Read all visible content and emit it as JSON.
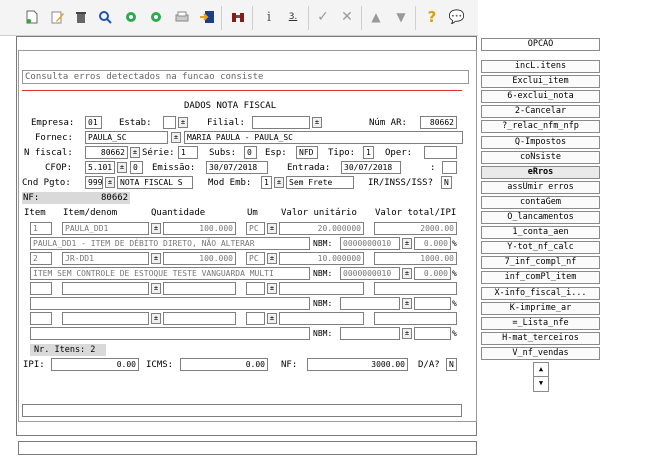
{
  "toolbar": {
    "icons": [
      "new-doc-icon",
      "edit-pencil-icon",
      "trash-icon",
      "search-icon",
      "circle-green-icon",
      "circle-green-2-icon",
      "print-icon",
      "exit-icon",
      "binoculars-icon",
      "info-i-icon",
      "info-3-icon",
      "check-icon",
      "cross-icon",
      "up-triangle-icon",
      "down-triangle-icon",
      "help-question-icon",
      "chat-icon"
    ],
    "info_3": "3."
  },
  "search_placeholder": "Consulta erros detectados na funcao consiste",
  "header_title": "DADOS NOTA FISCAL",
  "form": {
    "empresa_label": "Empresa:",
    "empresa": "01",
    "estab_label": "Estab:",
    "estab": "",
    "filial_label": "Filial:",
    "filial": "",
    "num_ar_label": "Núm AR:",
    "num_ar": "80662",
    "fornec_label": "Fornec:",
    "fornec_code": "PAULA_SC",
    "fornec_name": "MARIA PAULA - PAULA_SC",
    "nfiscal_label": "N fiscal:",
    "nfiscal": "80662",
    "serie_label": "Série:",
    "serie": "1",
    "subs_label": "Subs:",
    "subs": "0",
    "esp_label": "Esp:",
    "esp": "NFD",
    "tipo_label": "Tipo:",
    "tipo": "1",
    "oper_label": "Oper:",
    "oper": "",
    "cfop_label": "CFOP:",
    "cfop": "5.101",
    "cfop_seq": "0",
    "emissao_label": "Emissão:",
    "emissao": "30/07/2018",
    "entrada_label": "Entrada:",
    "entrada": "30/07/2018",
    "colon_label": ":",
    "cnd_label": "Cnd Pgto:",
    "cnd_code": "999",
    "cnd_desc": "NOTA FISCAL S",
    "modemb_label": "Mod Emb:",
    "modemb": "1",
    "modemb_desc": "Sem Frete",
    "ir_label": "IR/INSS/ISS?",
    "ir": "N",
    "nf_status_label": "NF:",
    "nf_status_value": "80662"
  },
  "items_header": {
    "item": "Item",
    "item_denom": "Item/denom",
    "quantidade": "Quantidade",
    "um": "Um",
    "valor_unitario": "Valor unitário",
    "valor_total": "Valor total/IPI"
  },
  "items": [
    {
      "item": "1",
      "code": "PAULA_DD1",
      "qty": "100.000",
      "um": "PC",
      "unit": "20.000000",
      "total": "2000.00",
      "desc": "PAULA_DD1 - ITEM DE DÉBITO DIRETO, NÃO ALTERAR",
      "nbm": "0000000010",
      "ipi": "0.000",
      "pct": "%"
    },
    {
      "item": "2",
      "code": "JR-DD1",
      "qty": "100.000",
      "um": "PC",
      "unit": "10.000000",
      "total": "1000.00",
      "desc": "ITEM SEM CONTROLE DE ESTOQUE TESTE VANGUARDA MULTI",
      "nbm": "0000000010",
      "ipi": "0.000",
      "pct": "%"
    }
  ],
  "nbm_label": "NBM:",
  "nr_itens": "Nr. Itens: 2",
  "totals": {
    "ipi_label": "IPI:",
    "ipi": "0.00",
    "icms_label": "ICMS:",
    "icms": "0.00",
    "nf_label": "NF:",
    "nf": "3000.00",
    "da_label": "D/A?",
    "da": "N"
  },
  "sidebar": {
    "title": "OPCAO",
    "items": [
      "incL.itens",
      "Exclui_item",
      "6-exclui_nota",
      "2-Cancelar",
      "?_relac_nfm_nfp",
      "Q-Impostos",
      "coNsiste",
      "eRros",
      "assUmir erros",
      "contaGem",
      "O_lancamentos",
      "1_conta_aen",
      "Y-tot_nf_calc",
      "7_inf_compl_nf",
      "inf_comPl_item",
      "X-info_fiscal_i...",
      "K-imprime_ar",
      "=_Lista_nfe",
      "H-mat_terceiros",
      "V_nf_vendas"
    ],
    "selected": "eRros"
  }
}
